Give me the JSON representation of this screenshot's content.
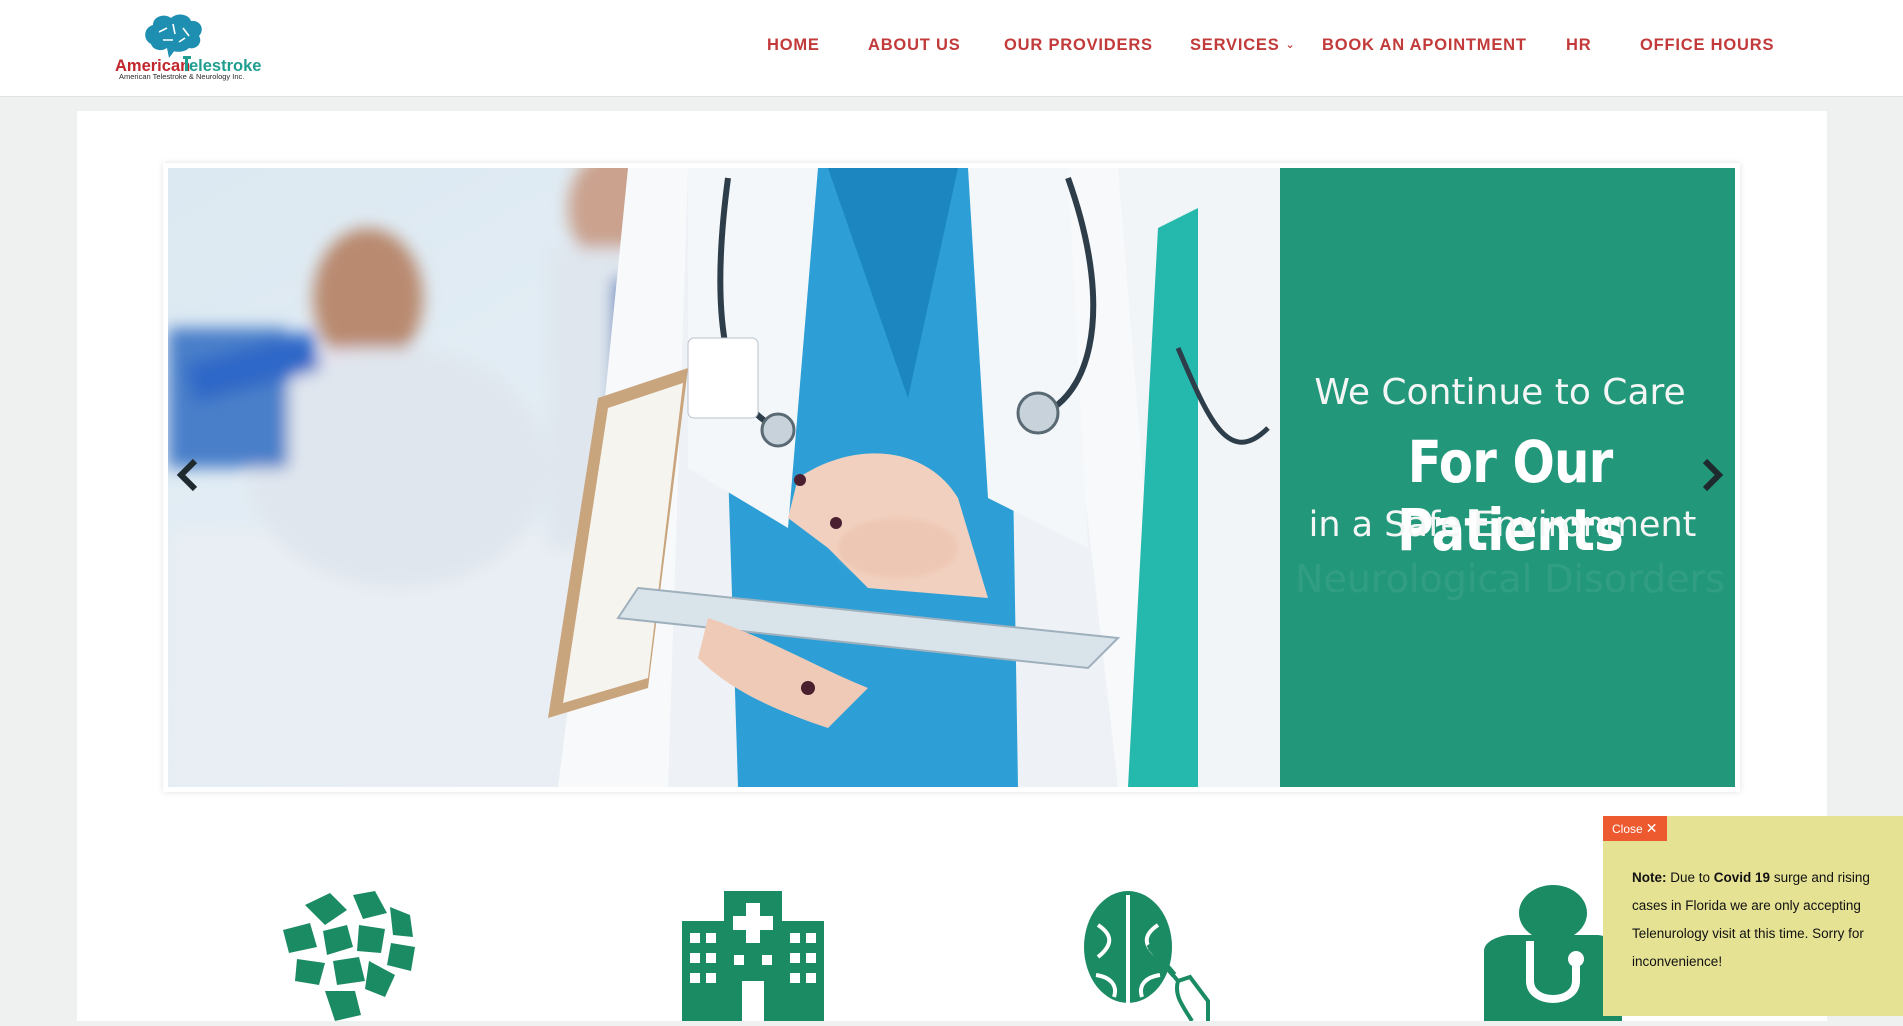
{
  "brand": {
    "name_part1": "American",
    "name_part2": "elestroke",
    "tagline": "American Telestroke & Neurology Inc.",
    "colors": {
      "red": "#c0262c",
      "teal": "#1f9e8f",
      "brain": "#1e8fb0"
    }
  },
  "nav": {
    "items": [
      {
        "label": "HOME"
      },
      {
        "label": "ABOUT US"
      },
      {
        "label": "OUR PROVIDERS"
      },
      {
        "label": "SERVICES",
        "has_dropdown": true
      },
      {
        "label": "BOOK AN APOINTMENT"
      },
      {
        "label": "HR"
      },
      {
        "label": "OFFICE HOURS"
      }
    ],
    "color": "#c23a3a"
  },
  "slider": {
    "line1": "We Continue to Care",
    "line2": "For Our Patients",
    "line3": "in a Safe Environment",
    "ghost_text": "Neurological Disorders",
    "panel_color": "#22977a",
    "prev_icon": "chevron-left-icon",
    "next_icon": "chevron-right-icon"
  },
  "features": {
    "icons": [
      "brain-puzzle-icon",
      "hospital-icon",
      "brain-hand-icon",
      "doctor-stethoscope-icon"
    ],
    "color": "#1b8b63"
  },
  "notice": {
    "close_label": "Close",
    "note_label": "Note:",
    "text_a": " Due to ",
    "covid_label": "Covid 19",
    "text_b": " surge and rising cases in Florida we are only accepting Telenurology visit at this time. Sorry for inconvenience!",
    "bg": "#e6e294",
    "close_bg": "#ee5a2f"
  }
}
